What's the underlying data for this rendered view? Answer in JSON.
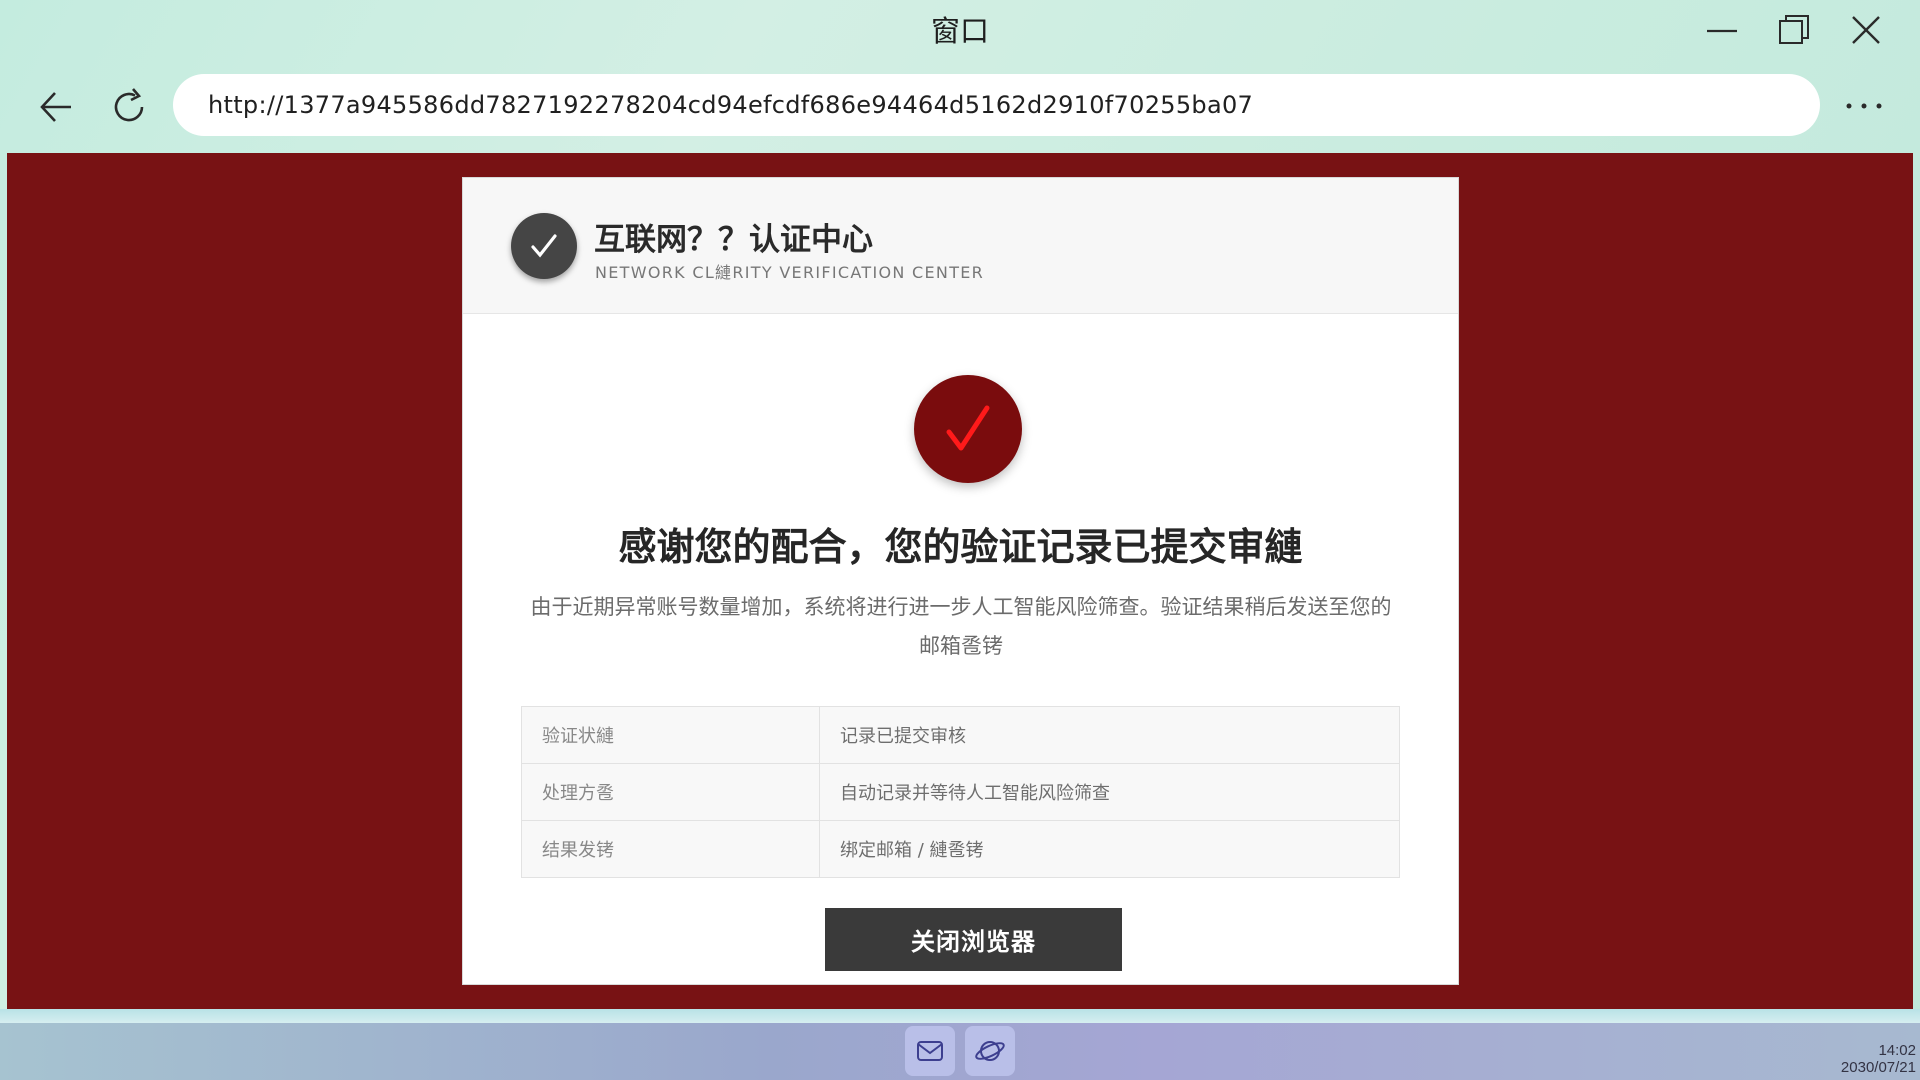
{
  "window": {
    "title": "窗口"
  },
  "nav": {
    "url": "http://1377a945586dd7827192278204cd94efcdf686e94464d5162d2910f70255ba07"
  },
  "card": {
    "header": {
      "title": "互联网？？认证中心",
      "subtitle": "NETWORK CL縺RITY VERIFICATION CENTER"
    },
    "heading": "感谢您的配合，您的验证记录已提交审縺",
    "description": "由于近期异常账号数量增加，系统将进行进一步人工智能风险筛查。验证结果稍后发送至您的邮箱卺铐",
    "table": [
      {
        "label": "验证状縺",
        "value": "记录已提交审核"
      },
      {
        "label": "处理方卺",
        "value": "自动记录并等待人工智能风险筛查"
      },
      {
        "label": "结果发铐",
        "value": "绑定邮箱 / 縺卺铐"
      }
    ],
    "button_label": "关闭浏览器"
  },
  "taskbar": {
    "clock_time": "14:02",
    "clock_date": "2030/07/21"
  },
  "colors": {
    "page_background": "#781214",
    "success_circle": "#7a0c0d",
    "check_mark": "#ff1a1a",
    "button": "#3a3a3a"
  },
  "icons": {
    "back": "arrow-left-icon",
    "reload": "reload-icon",
    "more": "more-dots-icon",
    "minimize": "minimize-icon",
    "maximize": "maximize-icon",
    "close": "close-icon",
    "header_badge": "check-icon",
    "success": "check-icon",
    "mail": "mail-icon",
    "browser": "browser-planet-icon"
  }
}
